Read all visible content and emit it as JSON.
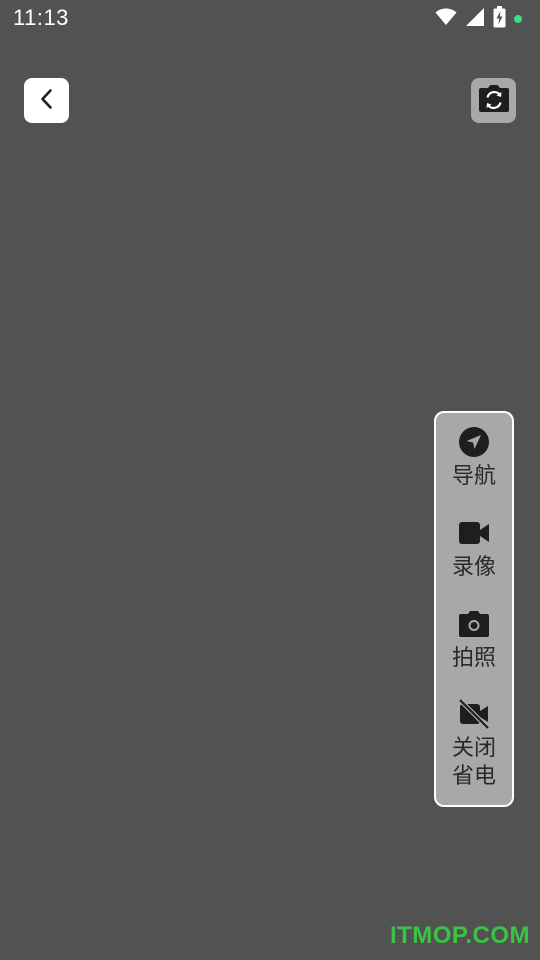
{
  "status_bar": {
    "time": "11:13",
    "icons": [
      "wifi-icon",
      "cell-signal-icon",
      "battery-charging-icon",
      "status-dot"
    ],
    "dot_color": "#3ddc84"
  },
  "toolbar": {
    "back_icon": "chevron-left-icon",
    "switch_camera_icon": "camera-switch-icon"
  },
  "side_panel": {
    "items": [
      {
        "label": "导航",
        "icon": "navigation-arrow-icon"
      },
      {
        "label": "录像",
        "icon": "video-camera-icon"
      },
      {
        "label": "拍照",
        "icon": "photo-camera-icon"
      },
      {
        "label": "关闭省电",
        "icon": "video-off-icon"
      }
    ]
  },
  "watermark": {
    "text": "ITMOP.COM",
    "color": "#3cc244"
  },
  "colors": {
    "background": "#525252",
    "panel": "#a8a8a8",
    "panel_border": "#ffffff",
    "icon": "#1e1e1e"
  }
}
